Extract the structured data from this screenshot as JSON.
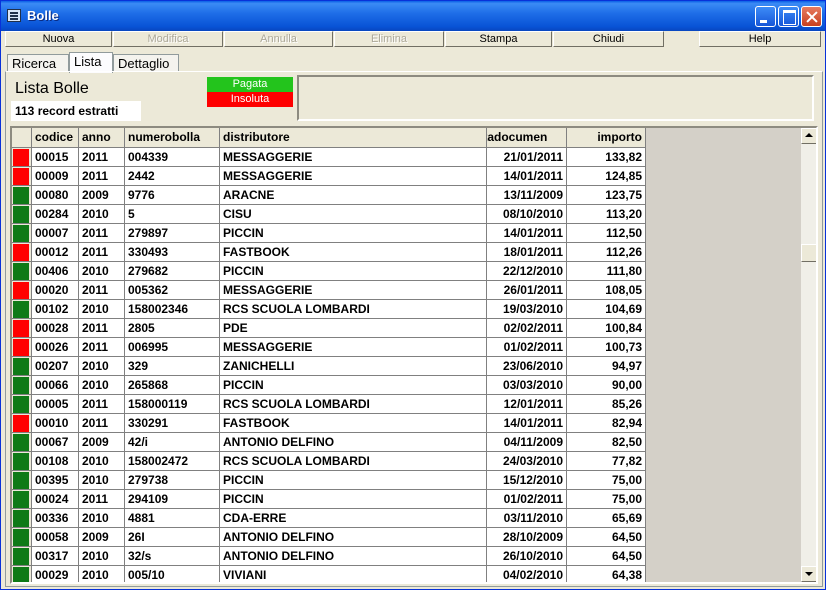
{
  "window": {
    "title": "Bolle"
  },
  "toolbar": [
    {
      "label": "Nuova",
      "enabled": true
    },
    {
      "label": "Modifica",
      "enabled": false
    },
    {
      "label": "Annulla",
      "enabled": false
    },
    {
      "label": "Elimina",
      "enabled": false
    },
    {
      "label": "Stampa",
      "enabled": true
    },
    {
      "label": "Chiudi",
      "enabled": true
    },
    {
      "label": "Help",
      "enabled": true
    }
  ],
  "tabs": [
    {
      "label": "Ricerca",
      "active": false
    },
    {
      "label": "Lista",
      "active": true
    },
    {
      "label": "Dettaglio",
      "active": false
    }
  ],
  "panel": {
    "title": "Lista Bolle",
    "record_count": "113 record estratti",
    "legend_paid": "Pagata",
    "legend_unpaid": "Insoluta"
  },
  "colors": {
    "paid": "#0f7a16",
    "unpaid": "#ff0000",
    "legend_paid": "#23c41c",
    "legend_unpaid": "#fe0000"
  },
  "table": {
    "columns": [
      "codice",
      "anno",
      "numerobolla",
      "distributore",
      "itadocumen",
      "importo"
    ],
    "rows": [
      {
        "status": "unpaid",
        "codice": "00015",
        "anno": "2011",
        "numero": "004339",
        "distributore": "MESSAGGERIE",
        "data": "21/01/2011",
        "importo": "133,82"
      },
      {
        "status": "unpaid",
        "codice": "00009",
        "anno": "2011",
        "numero": "2442",
        "distributore": "MESSAGGERIE",
        "data": "14/01/2011",
        "importo": "124,85"
      },
      {
        "status": "paid",
        "codice": "00080",
        "anno": "2009",
        "numero": "9776",
        "distributore": "ARACNE",
        "data": "13/11/2009",
        "importo": "123,75"
      },
      {
        "status": "paid",
        "codice": "00284",
        "anno": "2010",
        "numero": "5",
        "distributore": "CISU",
        "data": "08/10/2010",
        "importo": "113,20"
      },
      {
        "status": "paid",
        "codice": "00007",
        "anno": "2011",
        "numero": "279897",
        "distributore": "PICCIN",
        "data": "14/01/2011",
        "importo": "112,50"
      },
      {
        "status": "unpaid",
        "codice": "00012",
        "anno": "2011",
        "numero": "330493",
        "distributore": "FASTBOOK",
        "data": "18/01/2011",
        "importo": "112,26"
      },
      {
        "status": "paid",
        "codice": "00406",
        "anno": "2010",
        "numero": "279682",
        "distributore": "PICCIN",
        "data": "22/12/2010",
        "importo": "111,80"
      },
      {
        "status": "unpaid",
        "codice": "00020",
        "anno": "2011",
        "numero": "005362",
        "distributore": "MESSAGGERIE",
        "data": "26/01/2011",
        "importo": "108,05"
      },
      {
        "status": "paid",
        "codice": "00102",
        "anno": "2010",
        "numero": "158002346",
        "distributore": "RCS SCUOLA LOMBARDI",
        "data": "19/03/2010",
        "importo": "104,69"
      },
      {
        "status": "unpaid",
        "codice": "00028",
        "anno": "2011",
        "numero": "2805",
        "distributore": "PDE",
        "data": "02/02/2011",
        "importo": "100,84"
      },
      {
        "status": "unpaid",
        "codice": "00026",
        "anno": "2011",
        "numero": "006995",
        "distributore": "MESSAGGERIE",
        "data": "01/02/2011",
        "importo": "100,73"
      },
      {
        "status": "paid",
        "codice": "00207",
        "anno": "2010",
        "numero": "329",
        "distributore": "ZANICHELLI",
        "data": "23/06/2010",
        "importo": "94,97"
      },
      {
        "status": "paid",
        "codice": "00066",
        "anno": "2010",
        "numero": "265868",
        "distributore": "PICCIN",
        "data": "03/03/2010",
        "importo": "90,00"
      },
      {
        "status": "paid",
        "codice": "00005",
        "anno": "2011",
        "numero": "158000119",
        "distributore": "RCS SCUOLA LOMBARDI",
        "data": "12/01/2011",
        "importo": "85,26"
      },
      {
        "status": "unpaid",
        "codice": "00010",
        "anno": "2011",
        "numero": "330291",
        "distributore": "FASTBOOK",
        "data": "14/01/2011",
        "importo": "82,94"
      },
      {
        "status": "paid",
        "codice": "00067",
        "anno": "2009",
        "numero": "42/i",
        "distributore": "ANTONIO DELFINO",
        "data": "04/11/2009",
        "importo": "82,50"
      },
      {
        "status": "paid",
        "codice": "00108",
        "anno": "2010",
        "numero": "158002472",
        "distributore": "RCS SCUOLA LOMBARDI",
        "data": "24/03/2010",
        "importo": "77,82"
      },
      {
        "status": "paid",
        "codice": "00395",
        "anno": "2010",
        "numero": "279738",
        "distributore": "PICCIN",
        "data": "15/12/2010",
        "importo": "75,00"
      },
      {
        "status": "paid",
        "codice": "00024",
        "anno": "2011",
        "numero": "294109",
        "distributore": "PICCIN",
        "data": "01/02/2011",
        "importo": "75,00"
      },
      {
        "status": "paid",
        "codice": "00336",
        "anno": "2010",
        "numero": "4881",
        "distributore": "CDA-ERRE",
        "data": "03/11/2010",
        "importo": "65,69"
      },
      {
        "status": "paid",
        "codice": "00058",
        "anno": "2009",
        "numero": "26I",
        "distributore": "ANTONIO DELFINO",
        "data": "28/10/2009",
        "importo": "64,50"
      },
      {
        "status": "paid",
        "codice": "00317",
        "anno": "2010",
        "numero": "32/s",
        "distributore": "ANTONIO DELFINO",
        "data": "26/10/2010",
        "importo": "64,50"
      },
      {
        "status": "paid",
        "codice": "00029",
        "anno": "2010",
        "numero": "005/10",
        "distributore": "VIVIANI",
        "data": "04/02/2010",
        "importo": "64,38"
      }
    ]
  }
}
